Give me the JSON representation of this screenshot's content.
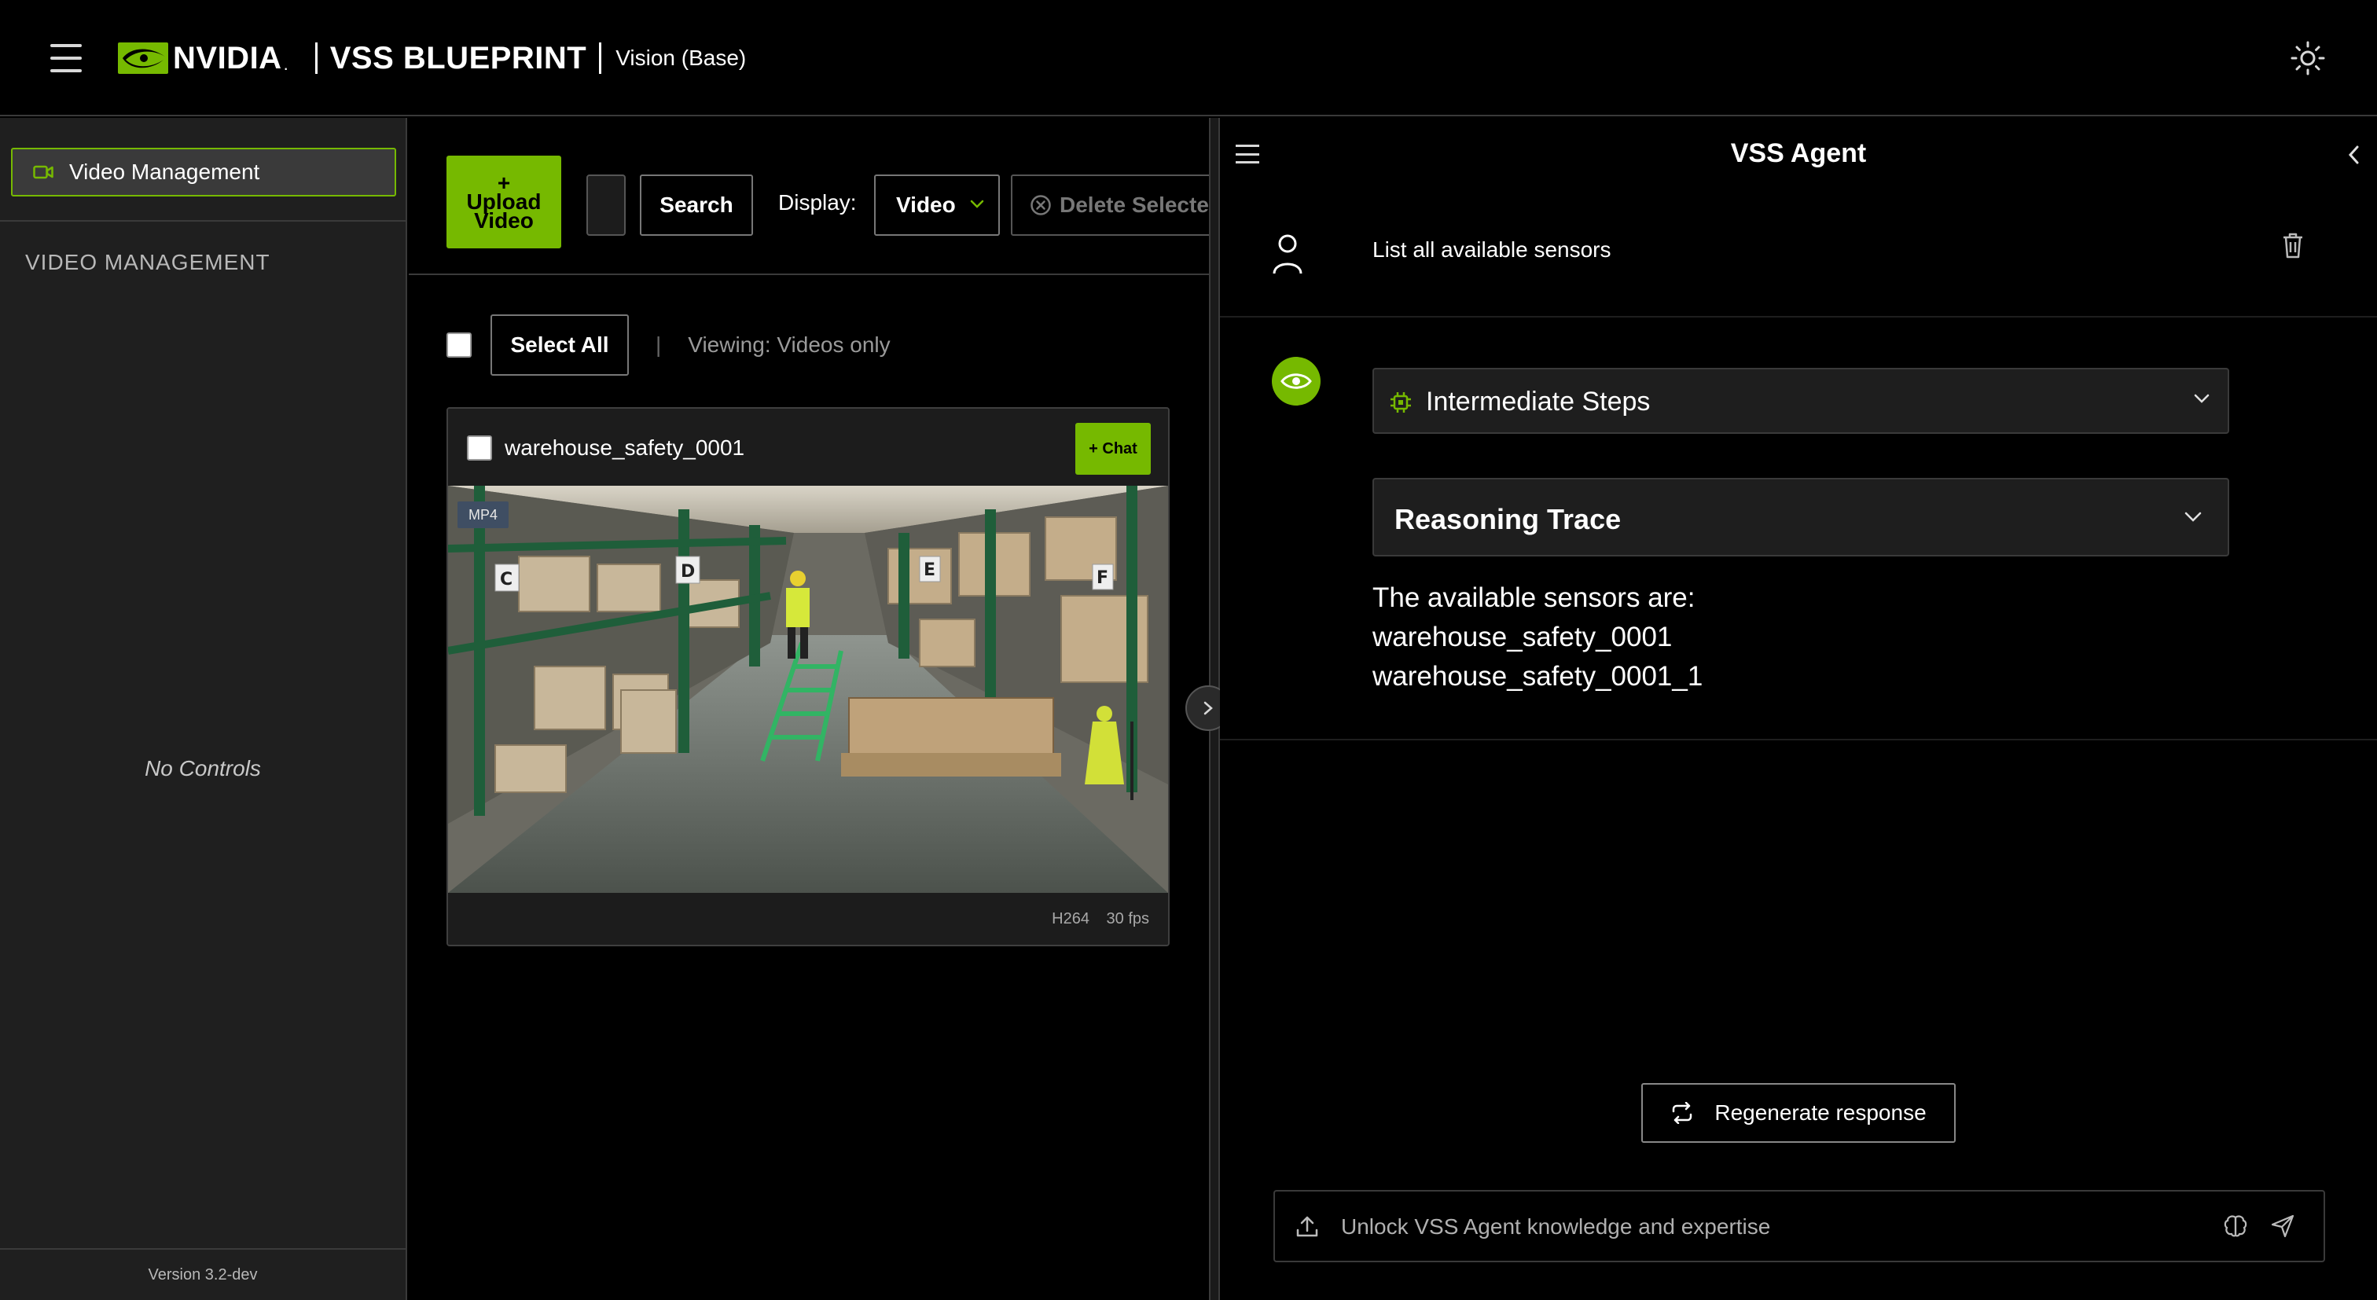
{
  "header": {
    "brand_word": "NVIDIA",
    "brand_dot": ".",
    "separator": "|",
    "title": "VSS BLUEPRINT",
    "subtitle": "Vision (Base)"
  },
  "sidebar": {
    "nav_items": [
      {
        "label": "Video Management",
        "icon": "video-camera-icon",
        "active": true
      }
    ],
    "section_title": "VIDEO MANAGEMENT",
    "empty_text": "No Controls",
    "version": "Version 3.2-dev"
  },
  "toolbar": {
    "upload_plus": "+",
    "upload_line1": "Upload",
    "upload_line2": "Video",
    "search_value": "",
    "search_label": "Search",
    "display_label": "Display:",
    "display_value": "Video",
    "delete_label": "Delete Selected"
  },
  "selection": {
    "select_all_label": "Select All",
    "separator": "|",
    "viewing_text": "Viewing: Videos only"
  },
  "videos": [
    {
      "name": "warehouse_safety_0001",
      "chat_label": "+ Chat",
      "format_badge": "MP4",
      "codec": "H264",
      "fps": "30 fps",
      "checked": false
    }
  ],
  "agent": {
    "title": "VSS Agent",
    "user_message": "List all available sensors",
    "intermediate_steps_label": "Intermediate Steps",
    "reasoning_trace_label": "Reasoning Trace",
    "answer_lines": [
      "The available sensors are:",
      "warehouse_safety_0001",
      "warehouse_safety_0001_1"
    ],
    "regenerate_label": "Regenerate response",
    "input_placeholder": "Unlock VSS Agent knowledge and expertise"
  },
  "colors": {
    "accent": "#76b900",
    "background": "#000000",
    "sidebar_bg": "#1f1f1f",
    "panel_border": "#3a3a3a",
    "badge_bg": "#3f4e63"
  },
  "icons": {
    "menu": "hamburger-menu-icon",
    "theme": "sun-icon",
    "collapse": "chevron-left-icon",
    "expand": "chevron-right-icon",
    "user": "user-icon",
    "delete": "trash-icon",
    "bot": "nvidia-eye-icon",
    "steps": "chip-icon",
    "regenerate": "repeat-icon",
    "upload": "upload-icon",
    "brain": "brain-icon",
    "send": "send-icon"
  }
}
